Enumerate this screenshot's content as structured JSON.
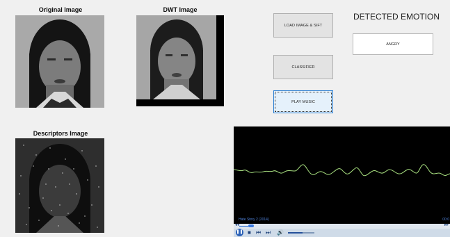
{
  "panels": {
    "original_title": "Original Image",
    "dwt_title": "DWT Image",
    "descriptors_title": "Descriptors Image"
  },
  "buttons": {
    "load_label": "LOAD IMAGE & SIFT",
    "classifier_label": "CLASSIFIER",
    "play_label": "PLAY MUSIC"
  },
  "emotion": {
    "heading": "DETECTED EMOTION",
    "value": "ANGRY"
  },
  "player": {
    "track": "Hate Story 2 (2014)",
    "time": "00:0",
    "seek_position": 0.05,
    "volume_level": 0.55
  }
}
